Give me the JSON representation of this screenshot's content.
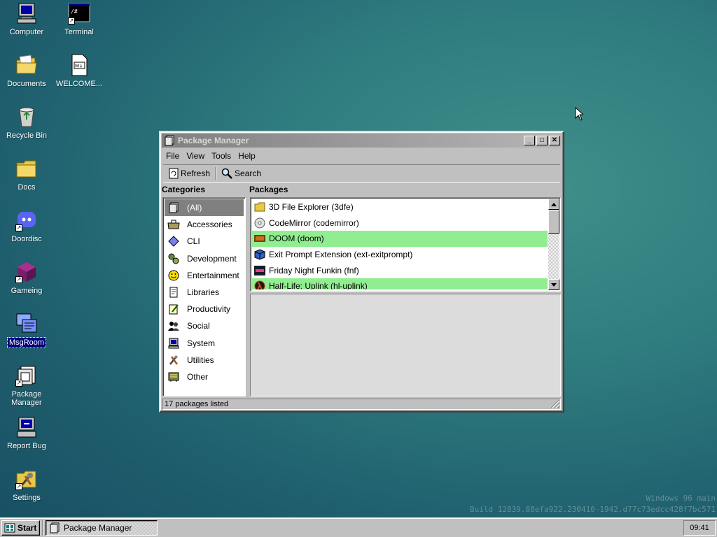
{
  "desktop": {
    "icons": [
      {
        "label": "Computer"
      },
      {
        "label": "Terminal"
      },
      {
        "label": "Documents"
      },
      {
        "label": "WELCOME..."
      },
      {
        "label": "Recycle Bin"
      },
      {
        "label": "Docs"
      },
      {
        "label": "Doordisc"
      },
      {
        "label": "Gameing"
      },
      {
        "label": "MsgRoom"
      },
      {
        "label": "Package\nManager"
      },
      {
        "label": "Report Bug"
      },
      {
        "label": "Settings"
      }
    ],
    "terminal_icon_text": "/#",
    "welcome_icon_text": "M↓",
    "watermark": {
      "line1": "Windows 96 main",
      "line2": "Build 12839.88efa922.230410-1942.d77c73edcc428f7bc571"
    }
  },
  "window": {
    "title": "Package Manager",
    "buttons": {
      "minimize": "_",
      "maximize": "□",
      "close": "✕"
    },
    "menu": [
      "File",
      "View",
      "Tools",
      "Help"
    ],
    "toolbar": {
      "refresh": "Refresh",
      "search": "Search"
    },
    "categories_label": "Categories",
    "packages_label": "Packages",
    "categories": [
      {
        "label": "(All)",
        "icon": "package-icon",
        "selected": true
      },
      {
        "label": "Accessories",
        "icon": "toolbox-icon"
      },
      {
        "label": "CLI",
        "icon": "diamond-icon"
      },
      {
        "label": "Development",
        "icon": "gears-icon"
      },
      {
        "label": "Entertainment",
        "icon": "smiley-icon"
      },
      {
        "label": "Libraries",
        "icon": "book-icon"
      },
      {
        "label": "Productivity",
        "icon": "document-pen-icon"
      },
      {
        "label": "Social",
        "icon": "people-icon"
      },
      {
        "label": "System",
        "icon": "computer-icon"
      },
      {
        "label": "Utilities",
        "icon": "tools-icon"
      },
      {
        "label": "Other",
        "icon": "board-icon"
      }
    ],
    "packages": [
      {
        "label": "3D File Explorer (3dfe)",
        "icon": "folder-icon",
        "installed": false
      },
      {
        "label": "CodeMirror (codemirror)",
        "icon": "disc-icon",
        "installed": false
      },
      {
        "label": "DOOM (doom)",
        "icon": "doom-icon",
        "installed": true
      },
      {
        "label": "Exit Prompt Extension (ext-exitprompt)",
        "icon": "cube-icon",
        "installed": false
      },
      {
        "label": "Friday Night Funkin (fnf)",
        "icon": "fnf-icon",
        "installed": false
      },
      {
        "label": "Half-Life: Uplink (hl-uplink)",
        "icon": "lambda-icon",
        "installed": true
      }
    ],
    "status": "17 packages listed"
  },
  "taskbar": {
    "start": "Start",
    "task": "Package Manager",
    "clock": "09:41"
  },
  "colors": {
    "installed_highlight": "#90ee90",
    "selection": "#000080",
    "window_face": "#c0c0c0"
  }
}
